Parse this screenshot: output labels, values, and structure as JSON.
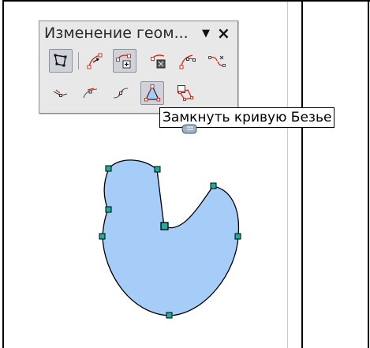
{
  "toolbar": {
    "title": "Изменение геом...",
    "menu_arrow": "▼",
    "close": "×",
    "row1": [
      {
        "name": "points-icon",
        "active": true
      },
      {
        "name": "move-points-icon",
        "active": false
      },
      {
        "name": "insert-points-icon",
        "active": true
      },
      {
        "name": "delete-points-icon",
        "active": false
      },
      {
        "name": "convert-to-curve-icon",
        "active": false
      },
      {
        "name": "split-curve-icon",
        "active": false
      }
    ],
    "row2": [
      {
        "name": "corner-point-icon",
        "active": false
      },
      {
        "name": "smooth-transition-icon",
        "active": false
      },
      {
        "name": "symmetric-transition-icon",
        "active": false
      },
      {
        "name": "close-bezier-icon",
        "active": true
      },
      {
        "name": "eliminate-points-icon",
        "active": false
      }
    ]
  },
  "tooltip": {
    "text": "Замкнуть кривую Безье"
  },
  "colors": {
    "shape_fill": "#a6cdf8",
    "shape_stroke": "#000000",
    "handle_fill": "#1ab0a0",
    "toolbar_bg": "#e8e8e8",
    "icon_red": "#d03020"
  }
}
